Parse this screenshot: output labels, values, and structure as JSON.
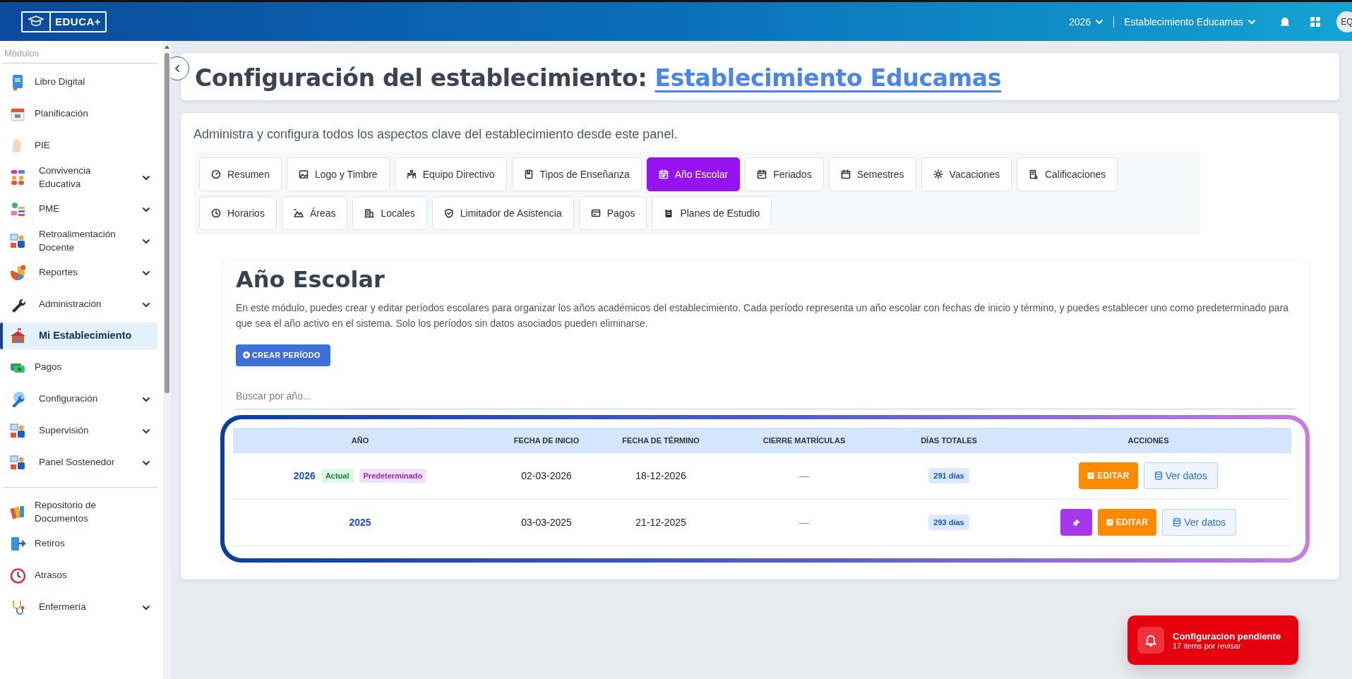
{
  "topbar": {
    "logo_text": "EDUCA+",
    "year": "2026",
    "establishment": "Establecimiento Educamas",
    "avatar": "EQ"
  },
  "sidebar": {
    "section_label": "Módulos",
    "items": [
      {
        "label": "Libro Digital",
        "expandable": false,
        "selected": false
      },
      {
        "label": "Planificación",
        "expandable": false,
        "selected": false
      },
      {
        "label": "PIE",
        "expandable": false,
        "selected": false
      },
      {
        "label": "Convivencia Educativa",
        "expandable": true,
        "selected": false
      },
      {
        "label": "PME",
        "expandable": true,
        "selected": false
      },
      {
        "label": "Retroalimentación Docente",
        "expandable": true,
        "selected": false
      },
      {
        "label": "Reportes",
        "expandable": true,
        "selected": false
      },
      {
        "label": "Administración",
        "expandable": true,
        "selected": false
      },
      {
        "label": "Mi Establecimiento",
        "expandable": false,
        "selected": true
      },
      {
        "label": "Pagos",
        "expandable": false,
        "selected": false
      },
      {
        "label": "Configuración",
        "expandable": true,
        "selected": false
      },
      {
        "label": "Supervisión",
        "expandable": true,
        "selected": false
      },
      {
        "label": "Panel Sostenedor",
        "expandable": true,
        "selected": false
      }
    ],
    "extra_items": [
      {
        "label": "Repositorio de Documentos",
        "expandable": false,
        "selected": false
      },
      {
        "label": "Retiros",
        "expandable": false,
        "selected": false
      },
      {
        "label": "Atrasos",
        "expandable": false,
        "selected": false
      },
      {
        "label": "Enfermería",
        "expandable": true,
        "selected": false
      }
    ]
  },
  "header": {
    "title": "Configuración del establecimiento:",
    "title_link": "Establecimiento Educamas"
  },
  "description": "Administra y configura todos los aspectos clave del establecimiento desde este panel.",
  "tabs": [
    {
      "label": "Resumen",
      "selected": false
    },
    {
      "label": "Logo y Timbre",
      "selected": false
    },
    {
      "label": "Equipo Directivo",
      "selected": false
    },
    {
      "label": "Tipos de Enseñanza",
      "selected": false
    },
    {
      "label": "Año Escolar",
      "selected": true
    },
    {
      "label": "Feriados",
      "selected": false
    },
    {
      "label": "Semestres",
      "selected": false
    },
    {
      "label": "Vacaciones",
      "selected": false
    },
    {
      "label": "Calificaciones",
      "selected": false
    },
    {
      "label": "Horarios",
      "selected": false
    },
    {
      "label": "Áreas",
      "selected": false
    },
    {
      "label": "Locales",
      "selected": false
    },
    {
      "label": "Limitador de Asistencia",
      "selected": false
    },
    {
      "label": "Pagos",
      "selected": false
    },
    {
      "label": "Planes de Estudio",
      "selected": false
    }
  ],
  "section": {
    "title": "Año Escolar",
    "description": "En este módulo, puedes crear y editar períodos escolares para organizar los años académicos del establecimiento. Cada período representa un año escolar con fechas de inicio y término, y puedes establecer uno como predeterminado para que sea el año activo en el sistema. Solo los períodos sin datos asociados pueden eliminarse.",
    "create_button": "CREAR PERÍODO",
    "search": {
      "placeholder": "Buscar por año..."
    }
  },
  "table": {
    "columns": [
      "AÑO",
      "FECHA DE INICIO",
      "FECHA DE TÉRMINO",
      "CIERRE MATRÍCULAS",
      "DÍAS TOTALES",
      "ACCIONES"
    ],
    "rows": [
      {
        "year": "2026",
        "badges": [
          {
            "label": "Actual",
            "kind": "current"
          },
          {
            "label": "Predeterminado",
            "kind": "default"
          }
        ],
        "start": "02-03-2026",
        "end": "18-12-2026",
        "closing": "—",
        "days": "291 días",
        "actions": [
          {
            "kind": "edit",
            "label": "EDITAR"
          },
          {
            "kind": "view",
            "label": "Ver datos"
          }
        ]
      },
      {
        "year": "2025",
        "badges": [],
        "start": "03-03-2025",
        "end": "21-12-2025",
        "closing": "—",
        "days": "293 días",
        "actions": [
          {
            "kind": "pin"
          },
          {
            "kind": "edit",
            "label": "EDITAR"
          },
          {
            "kind": "view",
            "label": "Ver datos"
          }
        ]
      }
    ]
  },
  "toast": {
    "title": "Configuracion pendiente",
    "subtitle": "17 items por revisar"
  }
}
